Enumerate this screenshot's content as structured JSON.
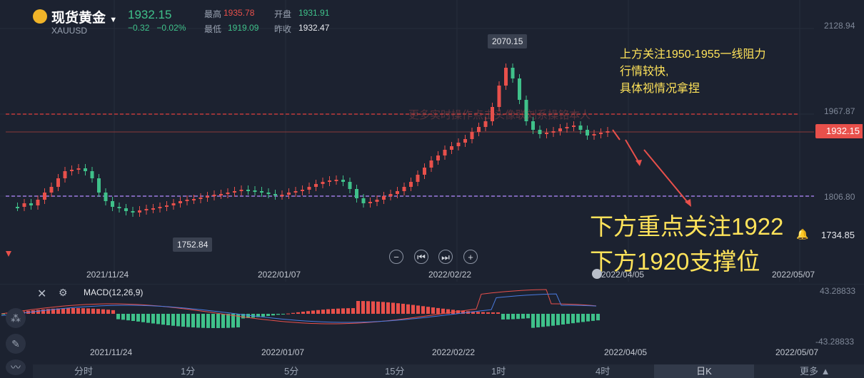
{
  "header": {
    "title": "现货黄金",
    "symbol": "XAUUSD",
    "price": "1932.15",
    "change": "−0.32",
    "change_pct": "−0.02%",
    "high_label": "最高",
    "high": "1935.78",
    "open_label": "开盘",
    "open": "1931.91",
    "low_label": "最低",
    "low": "1919.09",
    "prev_label": "昨收",
    "prev": "1932.47"
  },
  "yaxis": {
    "top": "2128.94",
    "r1": "1967.87",
    "current": "1932.15",
    "s1": "1806.80",
    "low": "1734.85"
  },
  "callouts": {
    "high": "2070.15",
    "low": "1752.84"
  },
  "annotations": {
    "resistance": [
      "上方关注1950-1955一线阻力",
      "行情较快,",
      "具体视情况拿捏"
    ],
    "focus": "下方重点关注1922",
    "support": "下方1920支撑位",
    "watermark": "更多实时操作点击头像联刘系操铭本人"
  },
  "xaxis": [
    "2021/11/24",
    "2022/01/07",
    "2022/02/22",
    "2022/04/05",
    "2022/05/07"
  ],
  "macd": {
    "label": "MACD(12,26,9)",
    "top": "43.28833",
    "bottom": "-43.28833"
  },
  "tabs": [
    "分时",
    "1分",
    "5分",
    "15分",
    "1时",
    "4时",
    "日K",
    "更多"
  ],
  "colors": {
    "up": "#e8504b",
    "down": "#3fc18a",
    "bg": "#1c2230",
    "annotation": "#ffe35a"
  }
}
